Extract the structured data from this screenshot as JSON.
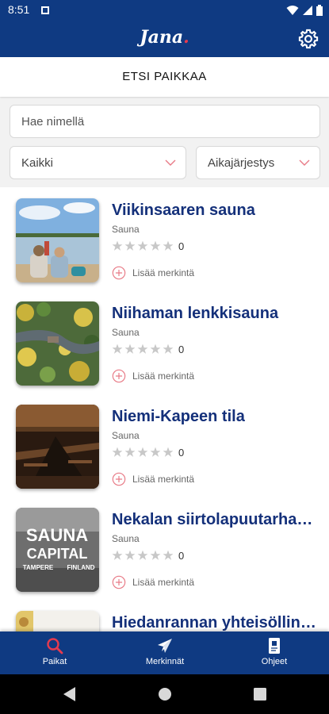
{
  "status_bar": {
    "time": "8:51"
  },
  "app": {
    "logo_text": "Jana",
    "logo_dot": "."
  },
  "page": {
    "title": "ETSI PAIKKAA"
  },
  "filters": {
    "search_placeholder": "Hae nimellä",
    "category_selected": "Kaikki",
    "sort_selected": "Aikajärjestys"
  },
  "places": [
    {
      "name": "Viikinsaaren sauna",
      "category": "Sauna",
      "rating_count": "0",
      "rating": 0,
      "add_label": "Lisää merkintä"
    },
    {
      "name": "Niihaman lenkkisauna",
      "category": "Sauna",
      "rating_count": "0",
      "rating": 0,
      "add_label": "Lisää merkintä"
    },
    {
      "name": "Niemi-Kapeen tila",
      "category": "Sauna",
      "rating_count": "0",
      "rating": 0,
      "add_label": "Lisää merkintä"
    },
    {
      "name": "Nekalan siirtolapuutarhan sauna",
      "category": "Sauna",
      "rating_count": "0",
      "rating": 0,
      "add_label": "Lisää merkintä",
      "thumb_text": [
        "SAUNA",
        "CAPITAL",
        "TAMPERE",
        "FINLAND"
      ]
    },
    {
      "name": "Hiedanrannan yhteisöllinen sauna"
    }
  ],
  "bottom_nav": [
    {
      "label": "Paikat",
      "icon": "search-icon"
    },
    {
      "label": "Merkinnät",
      "icon": "paper-plane-icon"
    },
    {
      "label": "Ohjeet",
      "icon": "document-icon"
    }
  ],
  "colors": {
    "primary": "#0f3a82",
    "title_text": "#14307a",
    "accent": "#e63a4e",
    "star_empty": "#c8c8c8"
  }
}
